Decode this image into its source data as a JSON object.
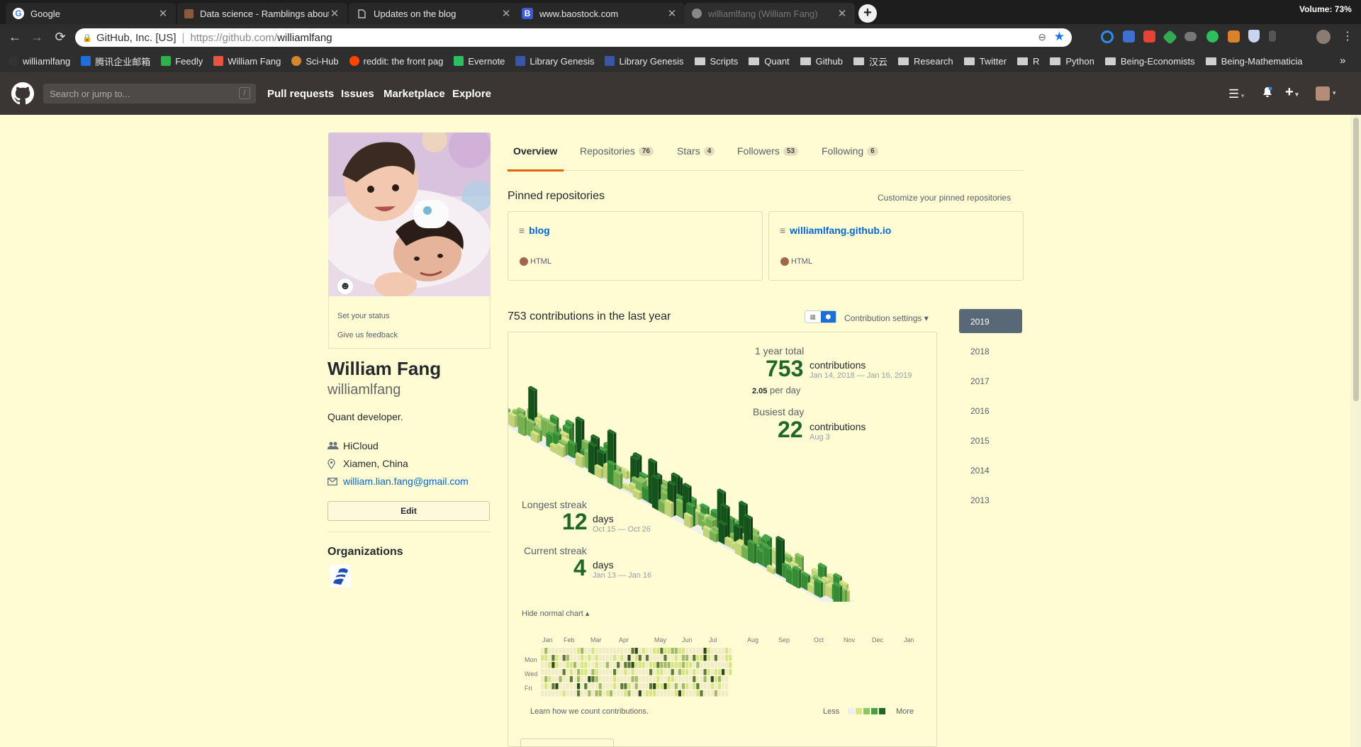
{
  "browser": {
    "tabs": [
      {
        "title": "Google",
        "icon": "google-icon",
        "active": false
      },
      {
        "title": "Data science - Ramblings about",
        "icon": "blog-icon",
        "active": false
      },
      {
        "title": "Updates on the blog",
        "icon": "page-icon",
        "active": false
      },
      {
        "title": "www.baostock.com",
        "icon": "baostock-icon",
        "active": false
      },
      {
        "title": "williamlfang (William Fang)",
        "icon": "github-icon",
        "active": true
      }
    ],
    "new_tab_label": "+",
    "volume": "Volume: 73%",
    "address": {
      "org": "GitHub, Inc. [US]",
      "url_host": "https://github.com/",
      "url_path": "williamlfang"
    },
    "bookmarks": [
      {
        "label": "williamlfang",
        "kind": "github",
        "color": "#333333"
      },
      {
        "label": "腾讯企业邮箱",
        "kind": "mail",
        "color": "#1e6fd9"
      },
      {
        "label": "Feedly",
        "kind": "feedly",
        "color": "#2bb24c"
      },
      {
        "label": "William Fang",
        "kind": "bolt",
        "color": "#e8553e"
      },
      {
        "label": "Sci-Hub",
        "kind": "scihub",
        "color": "#d4862a"
      },
      {
        "label": "reddit: the front pag",
        "kind": "reddit",
        "color": "#ff4500"
      },
      {
        "label": "Evernote",
        "kind": "evernote",
        "color": "#2dbe60"
      },
      {
        "label": "Library Genesis",
        "kind": "lib",
        "color": "#3a56a8"
      },
      {
        "label": "Library Genesis",
        "kind": "lib",
        "color": "#3a56a8"
      },
      {
        "label": "Scripts",
        "kind": "folder"
      },
      {
        "label": "Quant",
        "kind": "folder"
      },
      {
        "label": "Github",
        "kind": "folder"
      },
      {
        "label": "汉云",
        "kind": "folder"
      },
      {
        "label": "Research",
        "kind": "folder"
      },
      {
        "label": "Twitter",
        "kind": "folder"
      },
      {
        "label": "R",
        "kind": "folder"
      },
      {
        "label": "Python",
        "kind": "folder"
      },
      {
        "label": "Being-Economists",
        "kind": "folder"
      },
      {
        "label": "Being-Mathematicia",
        "kind": "folder"
      }
    ],
    "bookmarks_overflow": "»"
  },
  "github": {
    "search_placeholder": "Search or jump to...",
    "search_shortcut": "/",
    "nav": [
      "Pull requests",
      "Issues",
      "Marketplace",
      "Explore"
    ]
  },
  "profile": {
    "set_status": "Set your status",
    "feedback": "Give us feedback",
    "name": "William Fang",
    "login": "williamlfang",
    "bio": "Quant developer.",
    "company": "HiCloud",
    "location": "Xiamen, China",
    "email": "william.lian.fang@gmail.com",
    "edit_label": "Edit",
    "organizations_title": "Organizations"
  },
  "tabs": [
    {
      "label": "Overview",
      "count": ""
    },
    {
      "label": "Repositories",
      "count": "76"
    },
    {
      "label": "Stars",
      "count": "4"
    },
    {
      "label": "Followers",
      "count": "53"
    },
    {
      "label": "Following",
      "count": "6"
    }
  ],
  "pinned": {
    "title": "Pinned repositories",
    "customize": "Customize your pinned repositories",
    "repos": [
      {
        "name": "blog",
        "language": "HTML",
        "lang_color": "#a0684b"
      },
      {
        "name": "williamlfang.github.io",
        "language": "HTML",
        "lang_color": "#a0684b"
      }
    ]
  },
  "contrib": {
    "title": "753 contributions in the last year",
    "settings": "Contribution settings ▾",
    "year_total_label": "1 year total",
    "year_total": "753",
    "year_total_unit": "contributions",
    "year_range": "Jan 14, 2018 — Jan 16, 2019",
    "per_day_value": "2.05",
    "per_day_label": "per day",
    "busiest_label": "Busiest day",
    "busiest": "22",
    "busiest_unit": "contributions",
    "busiest_date": "Aug 3",
    "longest_label": "Longest streak",
    "longest": "12",
    "longest_unit": "days",
    "longest_range": "Oct 15 — Oct 26",
    "current_label": "Current streak",
    "current": "4",
    "current_unit": "days",
    "current_range": "Jan 13 — Jan 16",
    "hide_chart": "Hide normal chart ▴",
    "months": [
      "Jan",
      "Feb",
      "Mar",
      "Apr",
      "May",
      "Jun",
      "Jul",
      "Aug",
      "Sep",
      "Oct",
      "Nov",
      "Dec",
      "Jan"
    ],
    "weekdays": [
      "Mon",
      "Wed",
      "Fri"
    ],
    "learn": "Learn how we count contributions.",
    "less": "Less",
    "more": "More",
    "colors": [
      "#eeeeee",
      "#d6e685",
      "#8cc665",
      "#44a340",
      "#1e6823"
    ]
  },
  "years": [
    "2019",
    "2018",
    "2017",
    "2016",
    "2015",
    "2014",
    "2013"
  ]
}
